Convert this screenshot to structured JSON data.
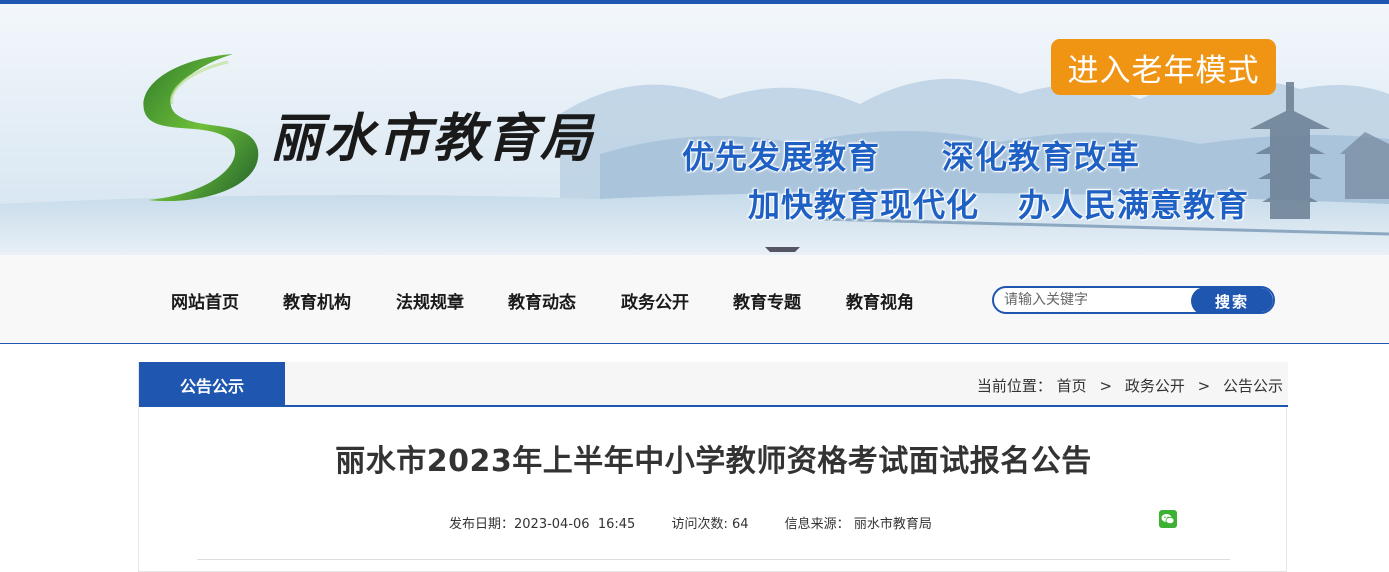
{
  "header": {
    "site_name": "丽水市教育局",
    "elder_mode_button": "进入老年模式",
    "slogans": [
      "优先发展教育",
      "深化教育改革",
      "加快教育现代化",
      "办人民满意教育"
    ]
  },
  "nav": {
    "items": [
      "网站首页",
      "教育机构",
      "法规规章",
      "教育动态",
      "政务公开",
      "教育专题",
      "教育视角"
    ],
    "search_placeholder": "请输入关键字",
    "search_button": "搜索"
  },
  "section": {
    "tab_label": "公告公示",
    "breadcrumb_prefix": "当前位置：",
    "breadcrumb": [
      "首页",
      "政务公开",
      "公告公示"
    ],
    "breadcrumb_separator": ">"
  },
  "article": {
    "title": "丽水市2023年上半年中小学教师资格考试面试报名公告",
    "publish_date_label": "发布日期：",
    "publish_date": "2023-04-06  16:45",
    "visits_label": "访问次数:",
    "visits": "64",
    "source_label": "信息来源：",
    "source": "丽水市教育局"
  },
  "colors": {
    "primary_blue": "#1f56b0",
    "elder_button": "#f09414",
    "slogan_blue": "#1f60c4",
    "wechat_green": "#3db134"
  },
  "icons": {
    "logo": "lishui-green-s-logo",
    "share": "wechat-icon"
  }
}
